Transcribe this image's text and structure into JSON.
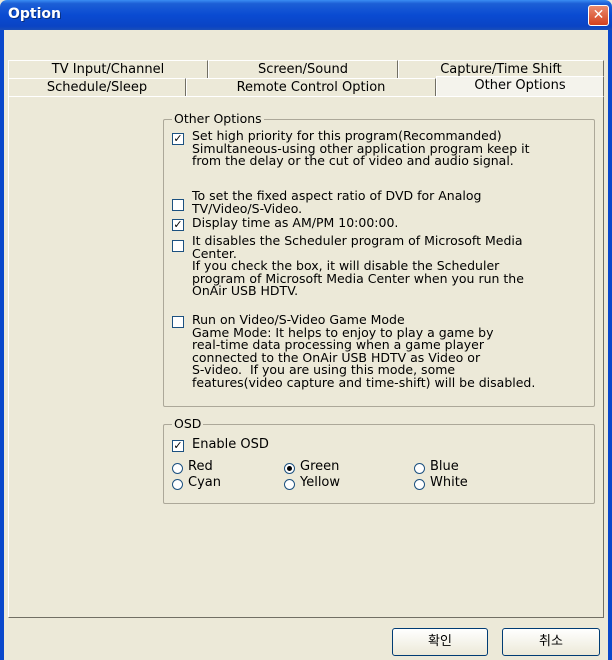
{
  "window": {
    "title": "Option",
    "close_glyph": "✕"
  },
  "tabs_row1": [
    {
      "label": "TV Input/Channel"
    },
    {
      "label": "Screen/Sound"
    },
    {
      "label": "Capture/Time Shift"
    }
  ],
  "tabs_row2": [
    {
      "label": "Schedule/Sleep"
    },
    {
      "label": "Remote Control Option"
    },
    {
      "label": "Other Options",
      "selected": true
    }
  ],
  "other_options": {
    "group_title": "Other Options",
    "items": [
      {
        "checked": true,
        "text": "Set high priority for this program(Recommanded)\nSimultaneous-using other application program keep it\nfrom the delay or the cut of video and audio signal."
      },
      {
        "checked": false,
        "text": "To set the fixed aspect ratio of DVD for Analog\nTV/Video/S-Video."
      },
      {
        "checked": true,
        "text": "Display time as AM/PM 10:00:00."
      },
      {
        "checked": false,
        "text": "It disables the Scheduler program of Microsoft Media\nCenter.\nIf you check the box, it will disable the Scheduler\nprogram of Microsoft Media Center when you run the\nOnAir USB HDTV."
      },
      {
        "checked": false,
        "text": "Run on Video/S-Video Game Mode\nGame Mode: It helps to enjoy to play a game by\nreal-time data processing when a game player\nconnected to the OnAir USB HDTV as Video or\nS-video.  If you are using this mode, some\nfeatures(video capture and time-shift) will be disabled."
      }
    ]
  },
  "osd": {
    "group_title": "OSD",
    "enable_label": "Enable OSD",
    "enable_checked": true,
    "colors": [
      {
        "label": "Red",
        "selected": false
      },
      {
        "label": "Green",
        "selected": true
      },
      {
        "label": "Blue",
        "selected": false
      },
      {
        "label": "Cyan",
        "selected": false
      },
      {
        "label": "Yellow",
        "selected": false
      },
      {
        "label": "White",
        "selected": false
      }
    ]
  },
  "buttons": {
    "ok": "확인",
    "cancel": "취소"
  }
}
